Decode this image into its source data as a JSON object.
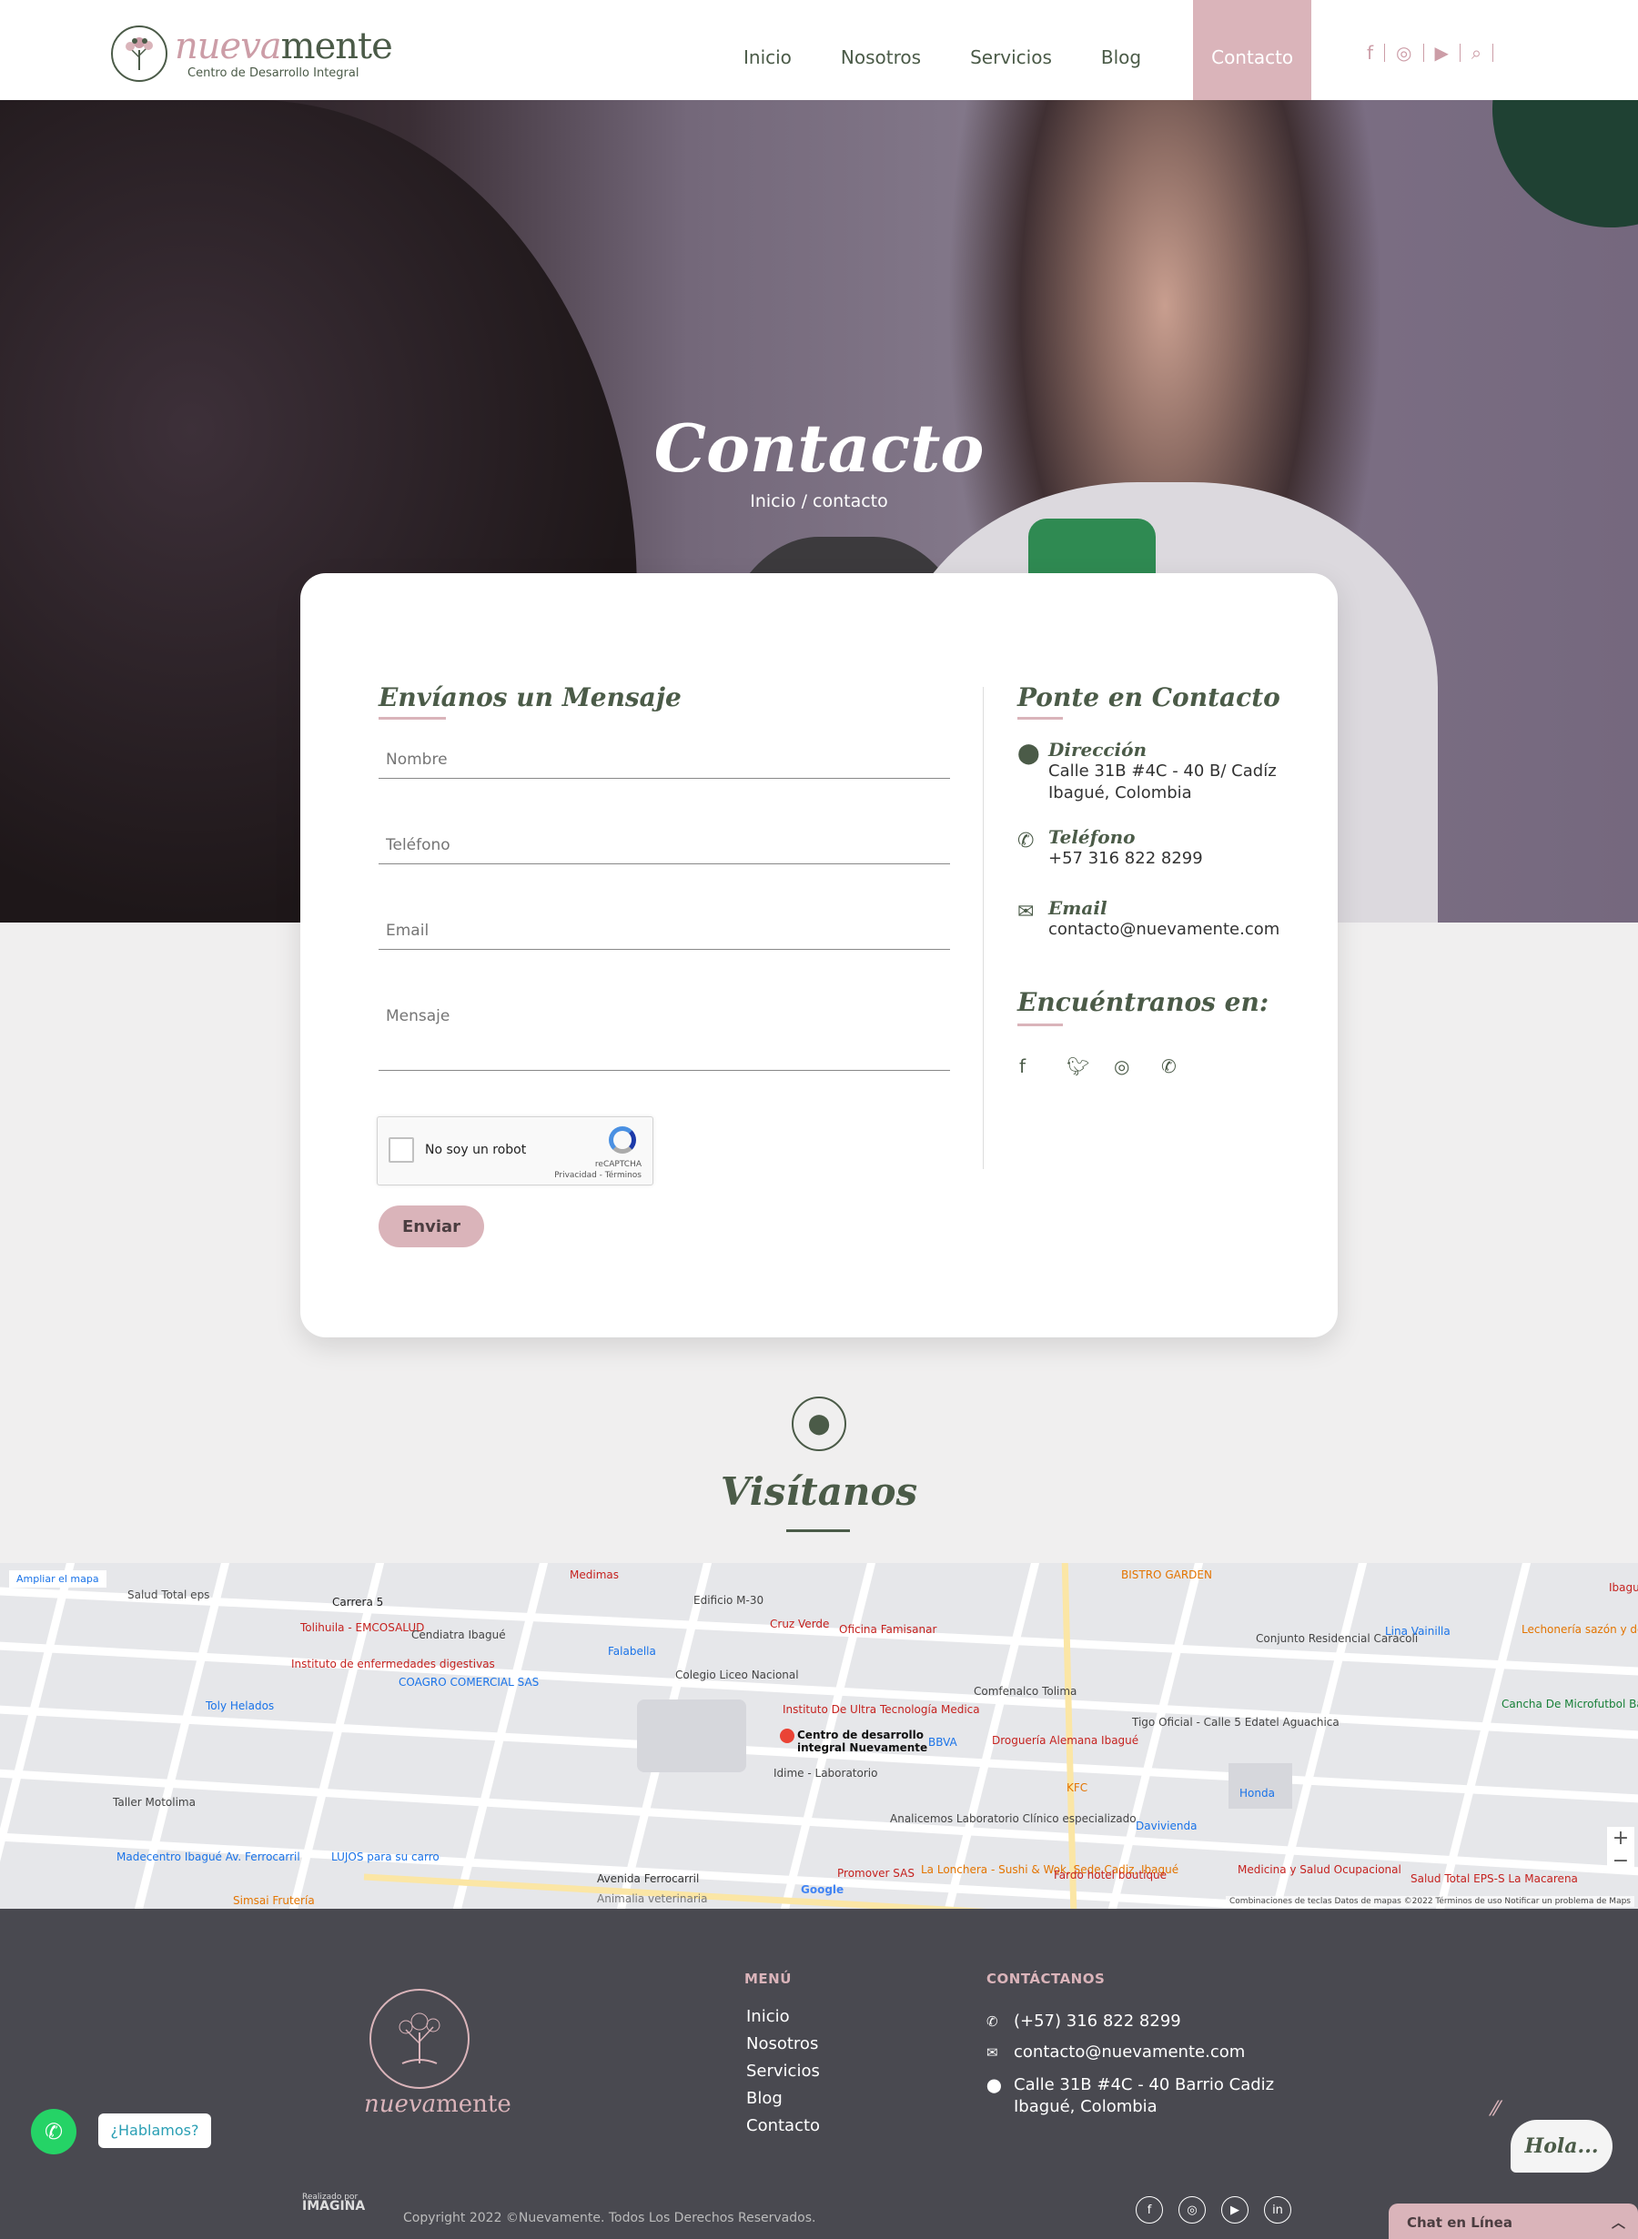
{
  "header": {
    "logo_word_a": "nueva",
    "logo_word_b": "mente",
    "logo_sub": "Centro de Desarrollo Integral",
    "nav": [
      "Inicio",
      "Nosotros",
      "Servicios",
      "Blog",
      "Contacto"
    ],
    "social_icons": [
      "facebook-icon",
      "instagram-icon",
      "youtube-icon",
      "search-icon"
    ]
  },
  "hero": {
    "title": "Contacto",
    "breadcrumb": "Inicio / contacto"
  },
  "form": {
    "title": "Envíanos un Mensaje",
    "name_placeholder": "Nombre",
    "phone_placeholder": "Teléfono",
    "email_placeholder": "Email",
    "message_placeholder": "Mensaje",
    "recaptcha_label": "No soy un robot",
    "recaptcha_brand": "reCAPTCHA",
    "recaptcha_links": "Privacidad - Términos",
    "submit_label": "Enviar"
  },
  "contact_info": {
    "title": "Ponte en Contacto",
    "address_label": "Dirección",
    "address_line1": "Calle 31B #4C - 40 B/ Cadíz",
    "address_line2": "Ibagué, Colombia",
    "phone_label": "Teléfono",
    "phone_value": "+57 316 822 8299",
    "email_label": "Email",
    "email_value": "contacto@nuevamente.com",
    "find_title": "Encuéntranos en:",
    "find_icons": [
      "facebook-icon",
      "twitter-icon",
      "instagram-icon",
      "whatsapp-icon"
    ]
  },
  "visit": {
    "title": "Visítanos"
  },
  "map": {
    "expand_label": "Ampliar el mapa",
    "place_name_1": "Centro de desarrollo",
    "place_name_2": "integral Nuevamente",
    "labels": [
      "Salud Total eps",
      "Carrera 5",
      "Tolihuila - EMCOSALUD",
      "Cendiatra Ibagué",
      "Instituto de enfermedades digestivas",
      "COAGRO COMERCIAL SAS",
      "Toly Helados",
      "Falabella",
      "Colegio Liceo Nacional",
      "Cruz Verde",
      "Oficina Famisanar",
      "Instituto De Ultra Tecnología Medica",
      "BBVA",
      "Droguería Alemana Ibagué",
      "Comfenalco Tolima",
      "Idime - Laboratorio",
      "Analicemos Laboratorio Clínico especializado",
      "KFC",
      "Davivienda",
      "Honda",
      "Medicina y Salud Ocupacional",
      "Salud Total EPS-S La Macarena",
      "Promover SAS",
      "La Lonchera - Sushi & Wok, Sede Cadiz, Ibagué",
      "Fardo hotel boutique",
      "Madecentro Ibagué Av. Ferrocarril",
      "LUJOS para su carro",
      "Simsai Frutería",
      "Avenida Ferrocarril",
      "Animalia veterinaria",
      "Taller Motolima",
      "Conjunto Residencial Caracoli",
      "Lina Vainilla",
      "Lechonería sazón y de Bufalo",
      "Cancha De Microfutbol Barrio Calarcá",
      "BISTRO GARDEN",
      "Medimas",
      "Edificio M-30",
      "Tigo Oficial - Calle 5 Edatel Aguachica",
      "Ibagué"
    ],
    "footer_text": "Combinaciones de teclas   Datos de mapas ©2022   Términos de uso   Notificar un problema de Maps",
    "google_label": "Google"
  },
  "footer": {
    "logo_word_a": "nueva",
    "logo_word_b": "mente",
    "menu_title": "MENÚ",
    "menu": [
      "Inicio",
      "Nosotros",
      "Servicios",
      "Blog",
      "Contacto"
    ],
    "contact_title": "CONTÁCTANOS",
    "phone": "(+57) 316 822 8299",
    "email": "contacto@nuevamente.com",
    "address_line1": "Calle 31B #4C - 40 Barrio Cadiz",
    "address_line2": "Ibagué, Colombia",
    "credit_small": "Realizado por",
    "credit_brand": "IMAGINA",
    "copyright": "Copyright 2022 ©Nuevamente. Todos Los Derechos Reservados.",
    "social_icons": [
      "facebook-icon",
      "instagram-icon",
      "youtube-icon",
      "linkedin-icon"
    ]
  },
  "widgets": {
    "whatsapp_bubble": "¿Hablamos?",
    "hola": "Hola...",
    "chat_label": "Chat en Línea"
  },
  "colors": {
    "primary_green": "#4b5b48",
    "accent_pink": "#dab4ba",
    "footer_bg": "#494950"
  }
}
